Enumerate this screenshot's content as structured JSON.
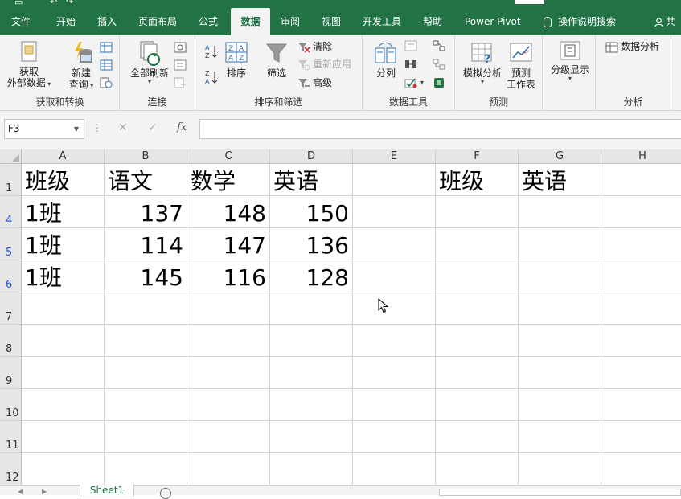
{
  "menubar": {
    "tabs": [
      "文件",
      "开始",
      "插入",
      "页面布局",
      "公式",
      "数据",
      "审阅",
      "视图",
      "开发工具",
      "帮助",
      "Power Pivot",
      "操作说明搜索",
      "共"
    ],
    "active_tab": "数据"
  },
  "ribbon": {
    "get_transform": {
      "get_external_line1": "获取",
      "get_external_line2": "外部数据",
      "new_query_line1": "新建",
      "new_query_line2": "查询",
      "label": "获取和转换"
    },
    "connections": {
      "refresh_all": "全部刷新",
      "label": "连接"
    },
    "sort_filter": {
      "sort": "排序",
      "filter": "筛选",
      "clear": "清除",
      "reapply": "重新应用",
      "advanced": "高级",
      "label": "排序和筛选"
    },
    "data_tools": {
      "text_to_columns": "分列",
      "label": "数据工具"
    },
    "forecast": {
      "what_if": "模拟分析",
      "forecast_sheet_line1": "预测",
      "forecast_sheet_line2": "工作表",
      "label": "预测"
    },
    "outline": {
      "label": "分级显示"
    },
    "analysis": {
      "data_analysis": "数据分析",
      "label": "分析"
    }
  },
  "formula_bar": {
    "name_box": "F3",
    "cancel_symbol": "✕",
    "enter_symbol": "✓",
    "fx_symbol": "fx",
    "formula": ""
  },
  "sheet": {
    "columns": [
      "A",
      "B",
      "C",
      "D",
      "E",
      "F",
      "G",
      "H"
    ],
    "row_numbers": [
      "1",
      "4",
      "5",
      "6",
      "7",
      "8",
      "9",
      "10",
      "11",
      "12"
    ],
    "filtered_rows": [
      "4",
      "5",
      "6"
    ],
    "rows": [
      [
        "班级",
        "语文",
        "数学",
        "英语",
        "",
        "班级",
        "英语",
        ""
      ],
      [
        "1班",
        "137",
        "148",
        "150",
        "",
        "",
        "",
        ""
      ],
      [
        "1班",
        "114",
        "147",
        "136",
        "",
        "",
        "",
        ""
      ],
      [
        "1班",
        "145",
        "116",
        "128",
        "",
        "",
        "",
        ""
      ],
      [
        "",
        "",
        "",
        "",
        "",
        "",
        "",
        ""
      ],
      [
        "",
        "",
        "",
        "",
        "",
        "",
        "",
        ""
      ],
      [
        "",
        "",
        "",
        "",
        "",
        "",
        "",
        ""
      ],
      [
        "",
        "",
        "",
        "",
        "",
        "",
        "",
        ""
      ],
      [
        "",
        "",
        "",
        "",
        "",
        "",
        "",
        ""
      ],
      [
        "",
        "",
        "",
        "",
        "",
        "",
        "",
        ""
      ]
    ]
  },
  "status": {
    "sheet_tab": "Sheet1",
    "accent_color": "#217346"
  }
}
